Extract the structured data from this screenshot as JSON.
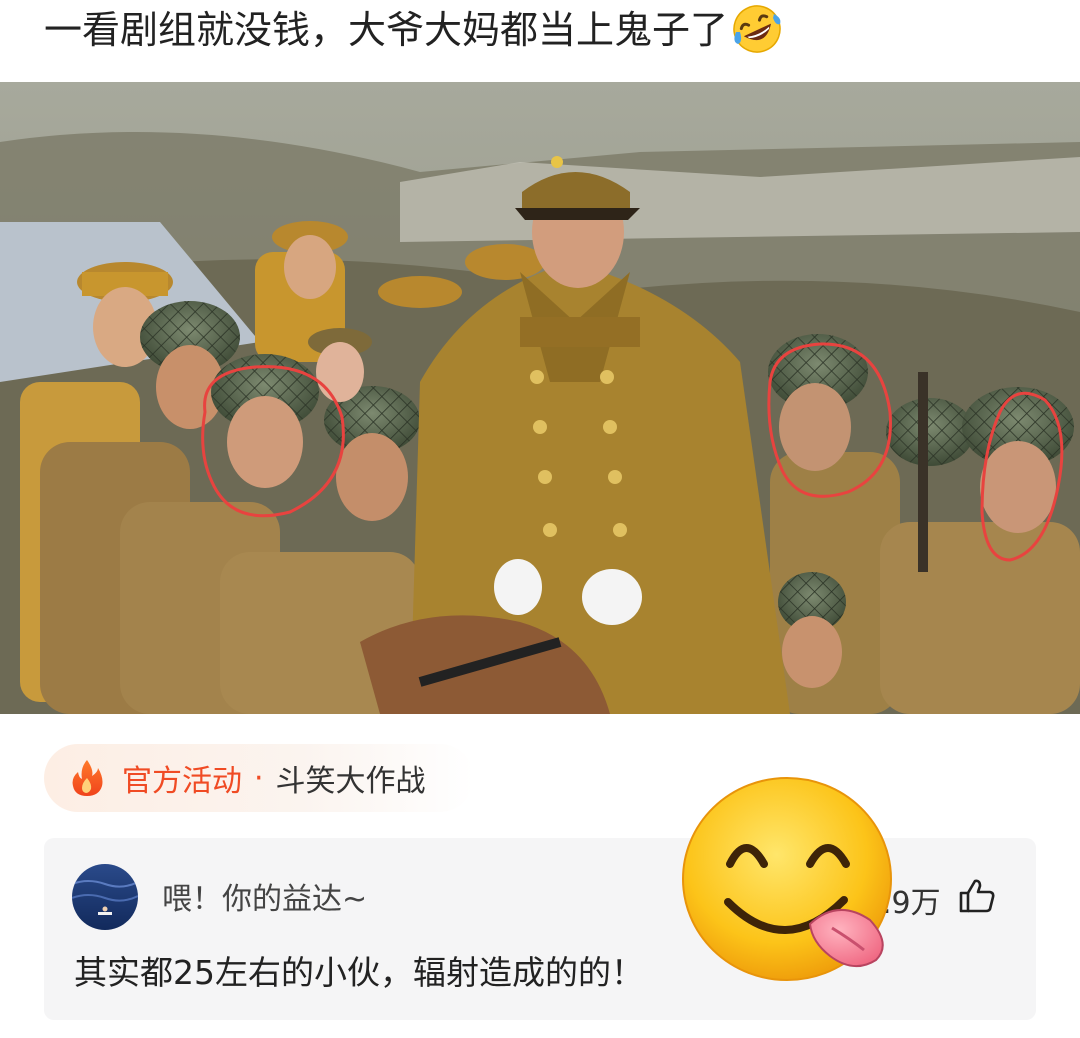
{
  "post": {
    "title": "一看剧组就没钱，大爷大妈都当上鬼子了",
    "title_emoji": "rolling-on-floor-laughing-emoji"
  },
  "photo": {
    "description_icon": "drama-still-photo",
    "annotation_color": "#e8433f"
  },
  "activity": {
    "icon": "flame-icon",
    "official_label": "官方活动",
    "separator": "·",
    "name": "斗笑大作战",
    "accent_color": "#f04b24"
  },
  "comment": {
    "username": "喂！你的益达~",
    "likes": ".9万",
    "like_icon": "thumbs-up-icon",
    "text": "其实都25左右的小伙，辐射造成的的！"
  },
  "sticker": {
    "icon": "yum-face-emoji"
  }
}
